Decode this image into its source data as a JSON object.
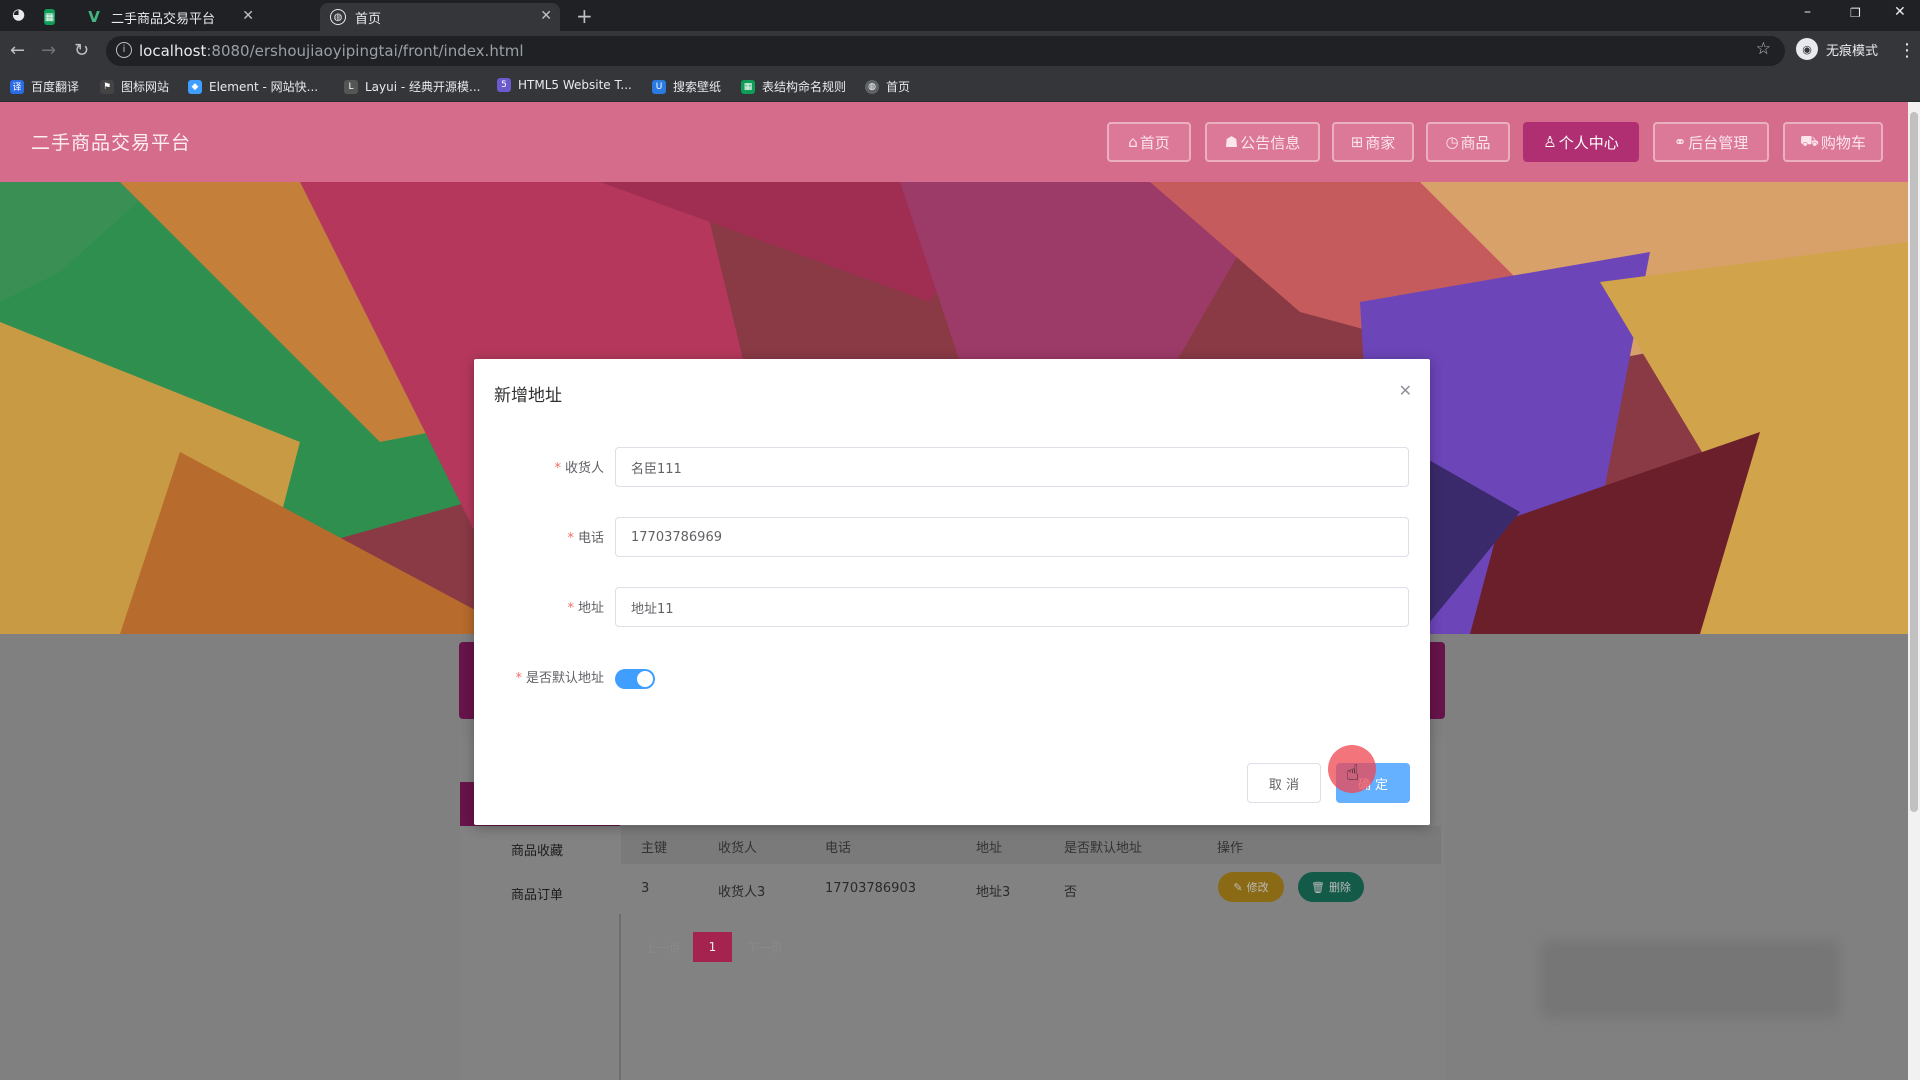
{
  "browser": {
    "tabs": [
      {
        "title": "二手商品交易平台",
        "active": false
      },
      {
        "title": "首页",
        "active": true
      }
    ],
    "url_host": "localhost",
    "url_path": ":8080/ershoujiaoyipingtai/front/index.html",
    "profile_label": "无痕模式",
    "window_controls": {
      "minimize": "–",
      "restore": "❐",
      "close": "✕"
    },
    "bookmarks": [
      {
        "label": "百度翻译",
        "icon": "baidu-translate-icon",
        "color": "#2b6ce6"
      },
      {
        "label": "图标网站",
        "icon": "flag-icon",
        "color": "#444"
      },
      {
        "label": "Element - 网站快...",
        "icon": "element-icon",
        "color": "#409eff"
      },
      {
        "label": "Layui - 经典开源模...",
        "icon": "layui-icon",
        "color": "#555"
      },
      {
        "label": "HTML5 Website T...",
        "icon": "html5-icon",
        "color": "#6a5acd"
      },
      {
        "label": "搜索壁纸",
        "icon": "wallpaper-icon",
        "color": "#2a7ae2"
      },
      {
        "label": "表结构命名规则",
        "icon": "table-icon",
        "color": "#0f9d58"
      },
      {
        "label": "首页",
        "icon": "globe-icon",
        "color": "#9aa0a6"
      }
    ]
  },
  "site": {
    "title": "二手商品交易平台",
    "nav": [
      {
        "label": "首页",
        "icon": "home-icon",
        "glyph": "⌂",
        "active": false
      },
      {
        "label": "公告信息",
        "icon": "announcement-icon",
        "glyph": "☗",
        "active": false
      },
      {
        "label": "商家",
        "icon": "store-icon",
        "glyph": "⊞",
        "active": false
      },
      {
        "label": "商品",
        "icon": "product-icon",
        "glyph": "◷",
        "active": false
      },
      {
        "label": "个人中心",
        "icon": "user-icon",
        "glyph": "♙",
        "active": true
      },
      {
        "label": "后台管理",
        "icon": "link-icon",
        "glyph": "⚭",
        "active": false
      },
      {
        "label": "购物车",
        "icon": "cart-icon",
        "glyph": "⛟",
        "active": false
      }
    ]
  },
  "sidebar": {
    "items": [
      "商品收藏",
      "商品订单"
    ]
  },
  "table": {
    "headers": [
      "主键",
      "收货人",
      "电话",
      "地址",
      "是否默认地址",
      "操作"
    ],
    "rows": [
      {
        "id": "3",
        "consignee": "收货人3",
        "phone": "17703786903",
        "address": "地址3",
        "is_default": "否"
      }
    ],
    "edit_label": "修改",
    "delete_label": "删除"
  },
  "pagination": {
    "prev": "上一页",
    "current": "1",
    "next": "下一页"
  },
  "dialog": {
    "title": "新增地址",
    "fields": {
      "consignee": {
        "label": "收货人",
        "value": "名臣111"
      },
      "phone": {
        "label": "电话",
        "value": "17703786969"
      },
      "address": {
        "label": "地址",
        "value": "地址11"
      },
      "is_default": {
        "label": "是否默认地址",
        "value": true
      }
    },
    "cancel_label": "取 消",
    "confirm_label": "确 定"
  },
  "colors": {
    "header": "#d66c8c",
    "nav_active": "#b02f72",
    "primary": "#409eff",
    "required": "#f56c6c"
  }
}
